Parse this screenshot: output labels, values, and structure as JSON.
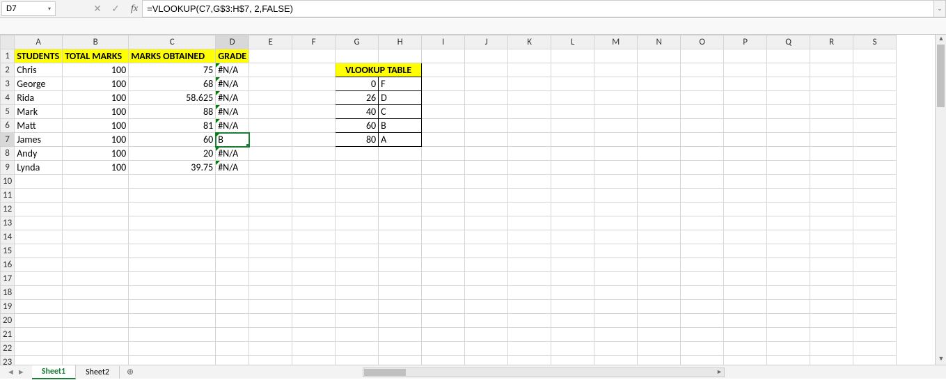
{
  "namebox": "D7",
  "formula": "=VLOOKUP(C7,G$3:H$7, 2,FALSE)",
  "columns": [
    "A",
    "B",
    "C",
    "D",
    "E",
    "F",
    "G",
    "H",
    "I",
    "J",
    "K",
    "L",
    "M",
    "N",
    "O",
    "P",
    "Q",
    "R",
    "S"
  ],
  "row_count": 23,
  "active": {
    "col": "D",
    "row": 7
  },
  "headers": {
    "A": "STUDENTS",
    "B": "TOTAL MARKS",
    "C": "MARKS OBTAINED",
    "D": "GRADE"
  },
  "students": [
    {
      "name": "Chris",
      "total": 100,
      "obtained": "75",
      "grade": "#N/A"
    },
    {
      "name": "George",
      "total": 100,
      "obtained": "68",
      "grade": "#N/A"
    },
    {
      "name": "Rida",
      "total": 100,
      "obtained": "58.625",
      "grade": "#N/A"
    },
    {
      "name": "Mark",
      "total": 100,
      "obtained": "88",
      "grade": "#N/A"
    },
    {
      "name": "Matt",
      "total": 100,
      "obtained": "81",
      "grade": "#N/A"
    },
    {
      "name": "James",
      "total": 100,
      "obtained": "60",
      "grade": "B"
    },
    {
      "name": "Andy",
      "total": 100,
      "obtained": "20",
      "grade": "#N/A"
    },
    {
      "name": "Lynda",
      "total": 100,
      "obtained": "39.75",
      "grade": "#N/A"
    }
  ],
  "vlookup_title": "VLOOKUP TABLE",
  "vlookup": [
    {
      "min": 0,
      "grade": "F"
    },
    {
      "min": 26,
      "grade": "D"
    },
    {
      "min": 40,
      "grade": "C"
    },
    {
      "min": 60,
      "grade": "B"
    },
    {
      "min": 80,
      "grade": "A"
    }
  ],
  "tabs": {
    "active": "Sheet1",
    "others": [
      "Sheet2"
    ],
    "add": "+"
  },
  "icons": {
    "cancel": "✕",
    "enter": "✓",
    "fx": "fx",
    "dd": "▾",
    "expand": "⌄",
    "navl": "◄",
    "navr": "►",
    "up": "▲",
    "down": "▼"
  }
}
